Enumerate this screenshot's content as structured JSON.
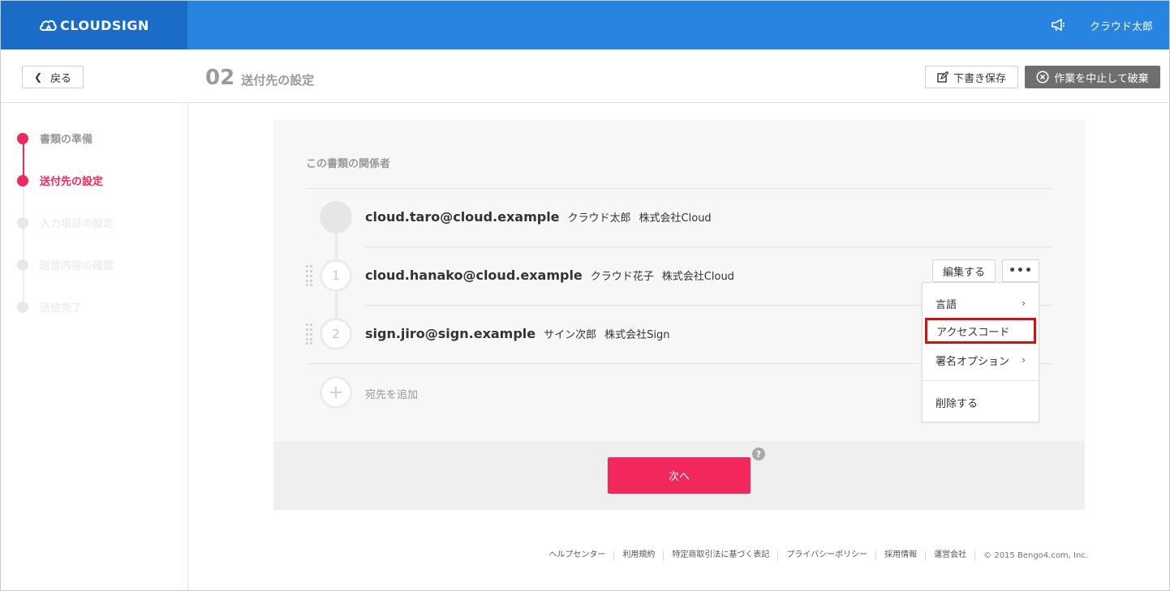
{
  "header": {
    "logo_text": "CLOUDSIGN",
    "user_name": "クラウド太郎",
    "brand_color": "#2784e0",
    "logo_bg_color": "#1a6cc7",
    "accent_color": "#f2285c"
  },
  "subheader": {
    "back_label": "戻る",
    "step_number": "02",
    "step_label": "送付先の設定",
    "draft_save_label": "下書き保存",
    "discard_label": "作業を中止して破棄"
  },
  "sidebar": {
    "steps": [
      {
        "label": "書類の準備",
        "state": "done"
      },
      {
        "label": "送付先の設定",
        "state": "active"
      },
      {
        "label": "入力項目の設定",
        "state": "pending"
      },
      {
        "label": "送信内容の確認",
        "state": "pending"
      },
      {
        "label": "送信完了",
        "state": "pending"
      }
    ]
  },
  "main": {
    "section_title": "この書類の関係者",
    "owner": {
      "email": "cloud.taro@cloud.example",
      "name": "クラウド太郎",
      "company": "株式会社Cloud"
    },
    "recipients": [
      {
        "order": "1",
        "email": "cloud.hanako@cloud.example",
        "name": "クラウド花子",
        "company": "株式会社Cloud"
      },
      {
        "order": "2",
        "email": "sign.jiro@sign.example",
        "name": "サイン次郎",
        "company": "株式会社Sign"
      }
    ],
    "edit_label": "編集する",
    "more_label": "•••",
    "add_recipient_label": "宛先を追加",
    "next_label": "次へ",
    "help_label": "?"
  },
  "dropdown": {
    "items": [
      {
        "label": "言語",
        "arrow": "›"
      },
      {
        "label": "アクセスコード",
        "arrow": ""
      },
      {
        "label": "署名オプション",
        "arrow": "›"
      },
      {
        "label": "削除する",
        "arrow": ""
      }
    ],
    "highlight_color": "#d90f0f"
  },
  "footer": {
    "links": [
      "ヘルプセンター",
      "利用規約",
      "特定商取引法に基づく表記",
      "プライバシーポリシー",
      "採用情報",
      "運営会社"
    ],
    "copyright": "© 2015 Bengo4.com, Inc."
  }
}
